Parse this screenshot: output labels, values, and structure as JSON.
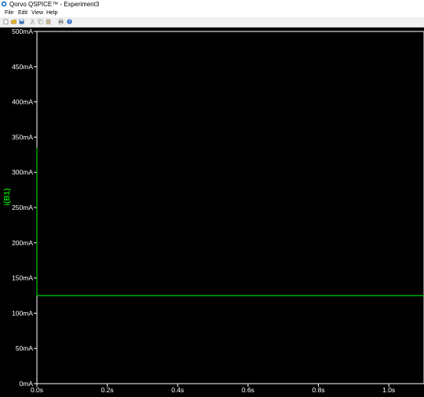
{
  "window": {
    "title": "Qorvo QSPICE™ - Experiment3"
  },
  "menu": [
    "File",
    "Edit",
    "View",
    "Help"
  ],
  "toolbar": [
    "new-file-icon",
    "open-folder-icon",
    "save-icon",
    "cut-icon",
    "copy-icon",
    "paste-icon",
    "print-icon",
    "help-icon"
  ],
  "colors": {
    "trace": "#00cc00",
    "axis": "#ffffff",
    "background": "#000000"
  },
  "chart_data": {
    "type": "line",
    "title": "",
    "xlabel": "",
    "ylabel": "i(B1)",
    "xlim": [
      0,
      1.1
    ],
    "ylim": [
      0,
      500
    ],
    "xticks": [
      0,
      0.2,
      0.4,
      0.6,
      0.8,
      1.0
    ],
    "xtick_labels": [
      "0.0s",
      "0.2s",
      "0.4s",
      "0.6s",
      "0.8s",
      "1.0s"
    ],
    "yticks": [
      0,
      50,
      100,
      150,
      200,
      250,
      300,
      350,
      400,
      450,
      500
    ],
    "ytick_labels": [
      "0mA",
      "50mA",
      "100mA",
      "150mA",
      "200mA",
      "250mA",
      "300mA",
      "350mA",
      "400mA",
      "450mA",
      "500mA"
    ],
    "grid": false,
    "series": [
      {
        "name": "i(B1)",
        "x": [
          0,
          0,
          1.1
        ],
        "y": [
          335,
          125,
          125
        ]
      }
    ]
  }
}
